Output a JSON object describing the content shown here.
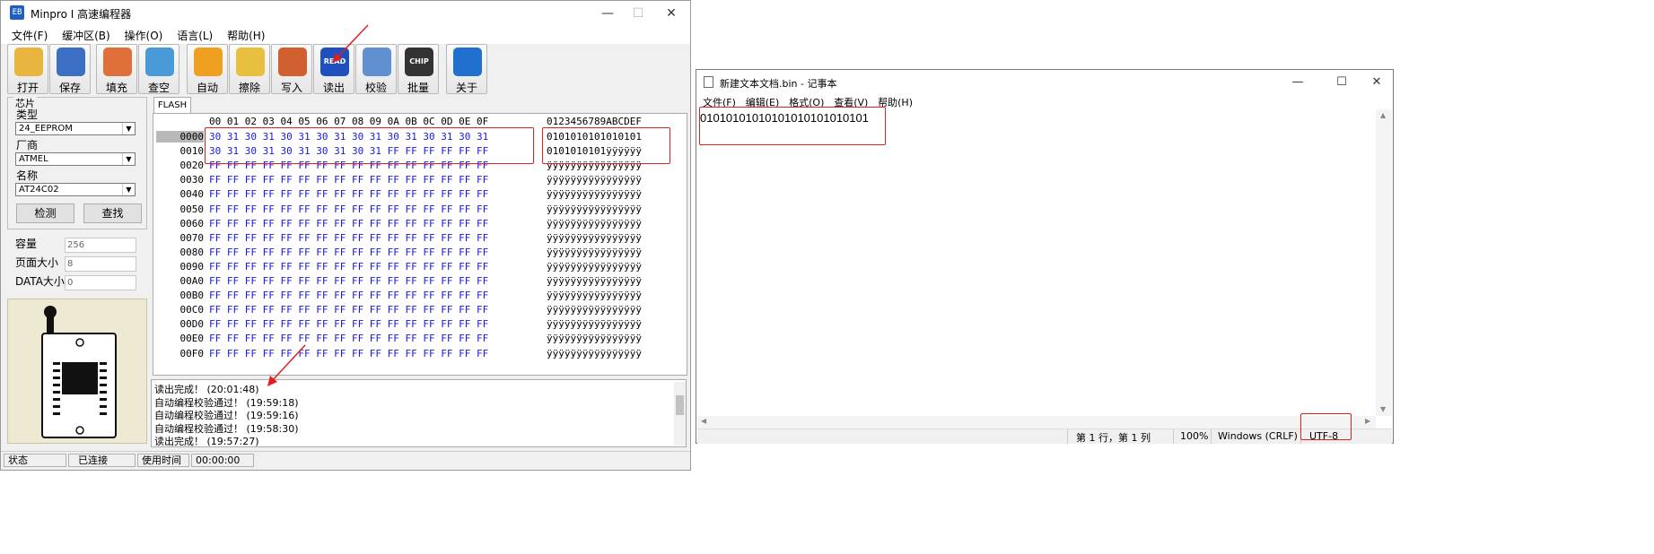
{
  "minpro": {
    "title": "Minpro I 高速编程器",
    "app_icon_text": "EB",
    "window_buttons": {
      "minimize": "—",
      "maximize": "☐",
      "close": "✕"
    },
    "menu": [
      "文件(F)",
      "缓冲区(B)",
      "操作(O)",
      "语言(L)",
      "帮助(H)"
    ],
    "toolbar": [
      {
        "label": "打开",
        "icon": "open-folder-icon",
        "color": "#e8b640"
      },
      {
        "label": "保存",
        "icon": "floppy-disk-icon",
        "color": "#3a6fc4"
      },
      {
        "label": "填充",
        "icon": "flask-icon",
        "color": "#e0703a"
      },
      {
        "label": "查空",
        "icon": "magnifier-icon",
        "color": "#4a9ad8"
      },
      {
        "label": "自动",
        "icon": "running-man-icon",
        "color": "#f0a020"
      },
      {
        "label": "擦除",
        "icon": "box-icon",
        "color": "#e8c040"
      },
      {
        "label": "写入",
        "icon": "pen-paper-icon",
        "color": "#d06030"
      },
      {
        "label": "读出",
        "icon": "read-disc-icon",
        "color": "#2050c0",
        "badge": "READ"
      },
      {
        "label": "校验",
        "icon": "magnifier-check-icon",
        "color": "#6090d0"
      },
      {
        "label": "批量",
        "icon": "chip-icon",
        "color": "#333333",
        "badge": "CHIP"
      },
      {
        "label": "关于",
        "icon": "help-icon",
        "color": "#2070d0"
      }
    ],
    "chip": {
      "section_label": "芯片",
      "type_label": "类型",
      "type_value": "24_EEPROM",
      "vendor_label": "厂商",
      "vendor_value": "ATMEL",
      "name_label": "名称",
      "name_value": "AT24C02",
      "detect_button": "检测",
      "search_button": "查找"
    },
    "info": {
      "capacity_label": "容量",
      "capacity_value": "256",
      "page_label": "页面大小",
      "page_value": "8",
      "data_label": "DATA大小",
      "data_value": "0"
    },
    "tab": "FLASH",
    "hex_header": "00 01 02 03 04 05 06 07 08 09 0A 0B 0C 0D 0E 0F",
    "ascii_header": "0123456789ABCDEF",
    "hex_rows": [
      {
        "addr": "0000",
        "hex": "30 31 30 31 30 31 30 31 30 31 30 31 30 31 30 31",
        "ascii": "0101010101010101"
      },
      {
        "addr": "0010",
        "hex": "30 31 30 31 30 31 30 31 30 31 FF FF FF FF FF FF",
        "ascii": "0101010101ÿÿÿÿÿÿ"
      },
      {
        "addr": "0020",
        "hex": "FF FF FF FF FF FF FF FF FF FF FF FF FF FF FF FF",
        "ascii": "ÿÿÿÿÿÿÿÿÿÿÿÿÿÿÿÿ"
      },
      {
        "addr": "0030",
        "hex": "FF FF FF FF FF FF FF FF FF FF FF FF FF FF FF FF",
        "ascii": "ÿÿÿÿÿÿÿÿÿÿÿÿÿÿÿÿ"
      },
      {
        "addr": "0040",
        "hex": "FF FF FF FF FF FF FF FF FF FF FF FF FF FF FF FF",
        "ascii": "ÿÿÿÿÿÿÿÿÿÿÿÿÿÿÿÿ"
      },
      {
        "addr": "0050",
        "hex": "FF FF FF FF FF FF FF FF FF FF FF FF FF FF FF FF",
        "ascii": "ÿÿÿÿÿÿÿÿÿÿÿÿÿÿÿÿ"
      },
      {
        "addr": "0060",
        "hex": "FF FF FF FF FF FF FF FF FF FF FF FF FF FF FF FF",
        "ascii": "ÿÿÿÿÿÿÿÿÿÿÿÿÿÿÿÿ"
      },
      {
        "addr": "0070",
        "hex": "FF FF FF FF FF FF FF FF FF FF FF FF FF FF FF FF",
        "ascii": "ÿÿÿÿÿÿÿÿÿÿÿÿÿÿÿÿ"
      },
      {
        "addr": "0080",
        "hex": "FF FF FF FF FF FF FF FF FF FF FF FF FF FF FF FF",
        "ascii": "ÿÿÿÿÿÿÿÿÿÿÿÿÿÿÿÿ"
      },
      {
        "addr": "0090",
        "hex": "FF FF FF FF FF FF FF FF FF FF FF FF FF FF FF FF",
        "ascii": "ÿÿÿÿÿÿÿÿÿÿÿÿÿÿÿÿ"
      },
      {
        "addr": "00A0",
        "hex": "FF FF FF FF FF FF FF FF FF FF FF FF FF FF FF FF",
        "ascii": "ÿÿÿÿÿÿÿÿÿÿÿÿÿÿÿÿ"
      },
      {
        "addr": "00B0",
        "hex": "FF FF FF FF FF FF FF FF FF FF FF FF FF FF FF FF",
        "ascii": "ÿÿÿÿÿÿÿÿÿÿÿÿÿÿÿÿ"
      },
      {
        "addr": "00C0",
        "hex": "FF FF FF FF FF FF FF FF FF FF FF FF FF FF FF FF",
        "ascii": "ÿÿÿÿÿÿÿÿÿÿÿÿÿÿÿÿ"
      },
      {
        "addr": "00D0",
        "hex": "FF FF FF FF FF FF FF FF FF FF FF FF FF FF FF FF",
        "ascii": "ÿÿÿÿÿÿÿÿÿÿÿÿÿÿÿÿ"
      },
      {
        "addr": "00E0",
        "hex": "FF FF FF FF FF FF FF FF FF FF FF FF FF FF FF FF",
        "ascii": "ÿÿÿÿÿÿÿÿÿÿÿÿÿÿÿÿ"
      },
      {
        "addr": "00F0",
        "hex": "FF FF FF FF FF FF FF FF FF FF FF FF FF FF FF FF",
        "ascii": "ÿÿÿÿÿÿÿÿÿÿÿÿÿÿÿÿ"
      }
    ],
    "log": [
      "读出完成！ (20:01:48)",
      "自动编程校验通过！ (19:59:18)",
      "自动编程校验通过！ (19:59:16)",
      "自动编程校验通过！ (19:58:30)",
      "读出完成！ (19:57:27)"
    ],
    "status": {
      "state_label": "状态",
      "state_value": "已连接",
      "time_label": "使用时间",
      "time_value": "00:00:00"
    }
  },
  "notepad": {
    "title": "新建文本文档.bin - 记事本",
    "window_buttons": {
      "minimize": "—",
      "maximize": "☐",
      "close": "✕"
    },
    "menu": [
      "文件(F)",
      "编辑(E)",
      "格式(O)",
      "查看(V)",
      "帮助(H)"
    ],
    "content": "01010101010101010101010101",
    "status": {
      "position": "第 1 行，第 1 列",
      "zoom": "100%",
      "line_ending": "Windows (CRLF)",
      "encoding": "UTF-8"
    }
  },
  "annotation_color": "#e02020"
}
